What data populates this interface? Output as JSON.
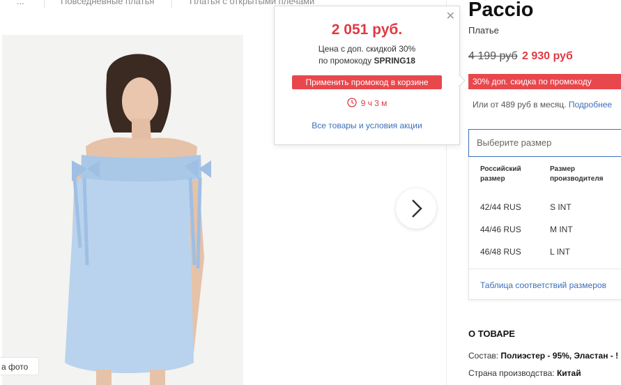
{
  "breadcrumb": {
    "items": [
      "...",
      "Повседневные платья",
      "Платья с открытыми плечами"
    ]
  },
  "gallery": {
    "photo_button_label": "а фото",
    "next_icon": "chevron-right-icon"
  },
  "promo_popup": {
    "price": "2 051 руб.",
    "line1": "Цена с доп. скидкой 30%",
    "line2_prefix": "по промокоду ",
    "promo_code": "SPRING18",
    "apply_button": "Применить промокод в корзине",
    "timer": "9 ч 3 м",
    "all_link": "Все товары и условия акции",
    "close_icon": "close-icon",
    "timer_icon": "clock-icon"
  },
  "product": {
    "brand": "Paccio",
    "type": "Платье",
    "old_price": "4 199 руб",
    "new_price": "2 930 руб",
    "discount_badge": "30% доп. скидка по промокоду",
    "installments_text": "Или от 489 руб в месяц.",
    "installments_link": "Подробнее"
  },
  "size_selector": {
    "placeholder": "Выберите размер",
    "col1_line1": "Российский",
    "col1_line2": "размер",
    "col2_line1": "Размер",
    "col2_line2": "производителя",
    "rows": [
      {
        "ru": "42/44 RUS",
        "maker": "S INT"
      },
      {
        "ru": "44/46 RUS",
        "maker": "M INT"
      },
      {
        "ru": "46/48 RUS",
        "maker": "L INT"
      }
    ],
    "table_link": "Таблица соответствий размеров"
  },
  "about": {
    "title": "О ТОВАРЕ",
    "composition_label": "Состав: ",
    "composition_value": "Полиэстер - 95%, Эластан - !",
    "country_label": "Страна производства: ",
    "country_value": "Китай"
  },
  "colors": {
    "accent_red": "#e03a43",
    "link_blue": "#3a6fb8",
    "dress_blue": "#b9d3ee"
  }
}
